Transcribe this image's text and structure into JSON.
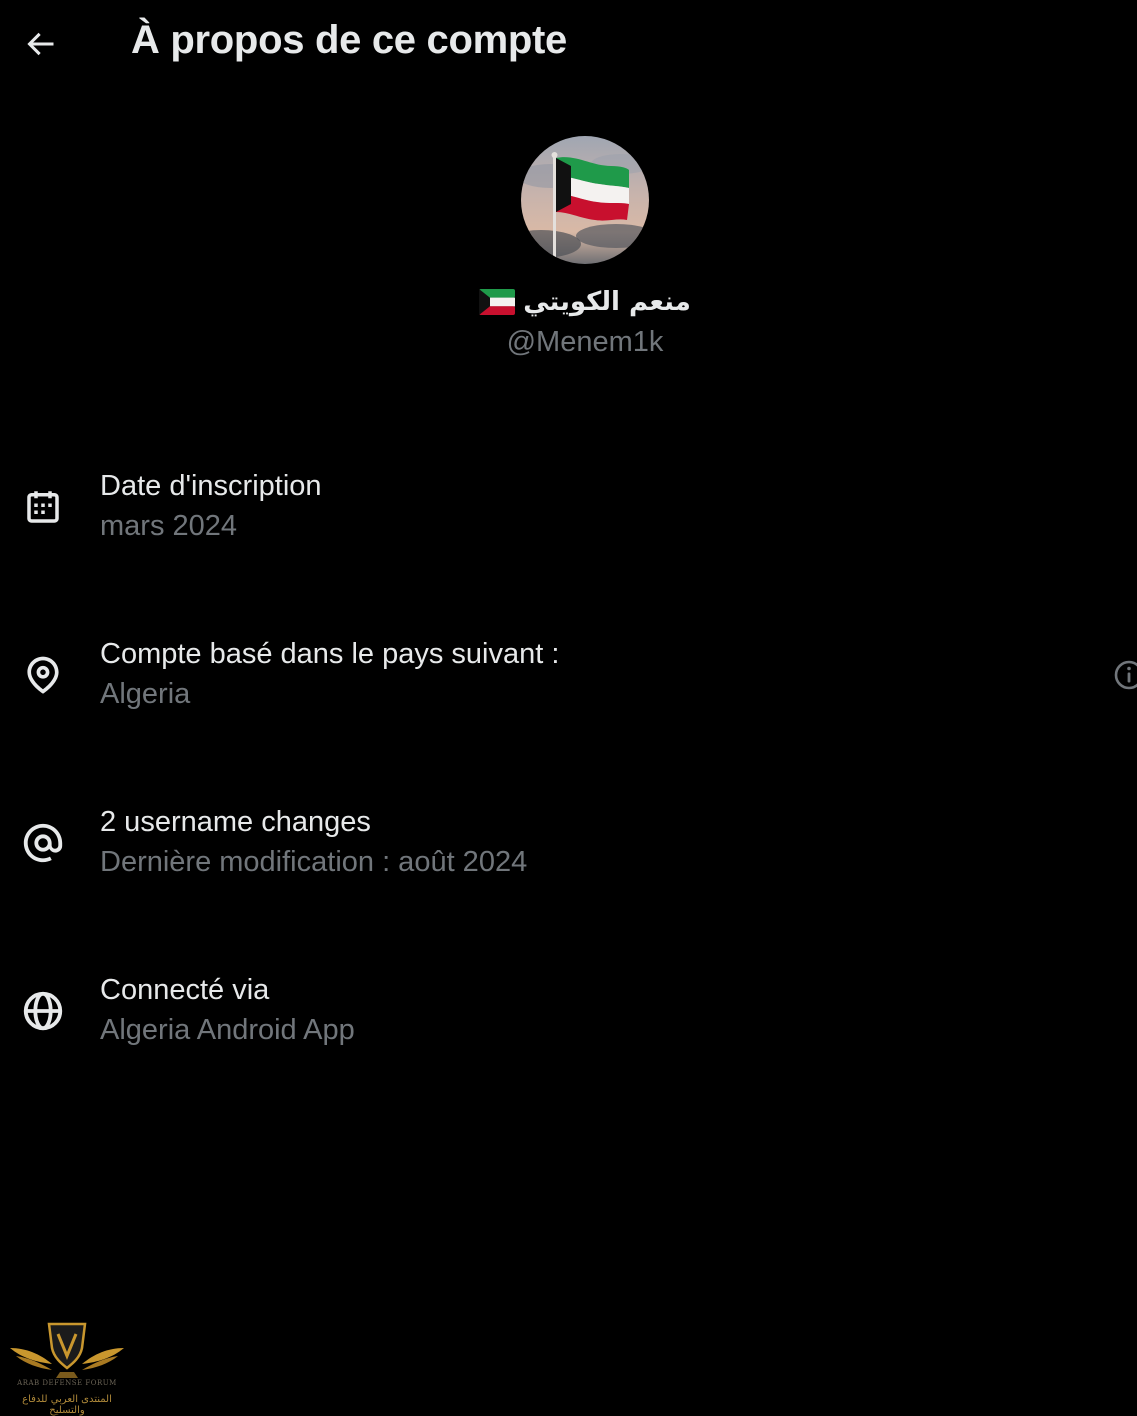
{
  "header": {
    "back_icon": "arrow-left-icon",
    "title": "À propos de ce compte"
  },
  "profile": {
    "avatar_description_icon": "avatar-kuwait-flag",
    "display_name": "منعم الكويتي",
    "name_flag_icon": "kuwait-flag-emoji",
    "handle": "@Menem1k"
  },
  "info": [
    {
      "icon": "calendar-icon",
      "label": "Date d'inscription",
      "value": "mars 2024"
    },
    {
      "icon": "location-pin-icon",
      "label": "Compte basé dans le pays suivant :",
      "value": "Algeria",
      "help_icon": "info-icon"
    },
    {
      "icon": "at-sign-icon",
      "label": "2 username changes",
      "value": "Dernière modification : août 2024"
    },
    {
      "icon": "globe-icon",
      "label": "Connecté via",
      "value": "Algeria Android App"
    }
  ],
  "watermark": {
    "text_en": "ARAB DEFENSE FORUM",
    "text_ar": "المنتدى العربي للدفاع والتسليح"
  },
  "colors": {
    "background": "#000000",
    "primary_text": "#e7e9ea",
    "secondary_text": "#71767b",
    "kuwait_green": "#1f9a4a",
    "kuwait_red": "#c8102e"
  }
}
